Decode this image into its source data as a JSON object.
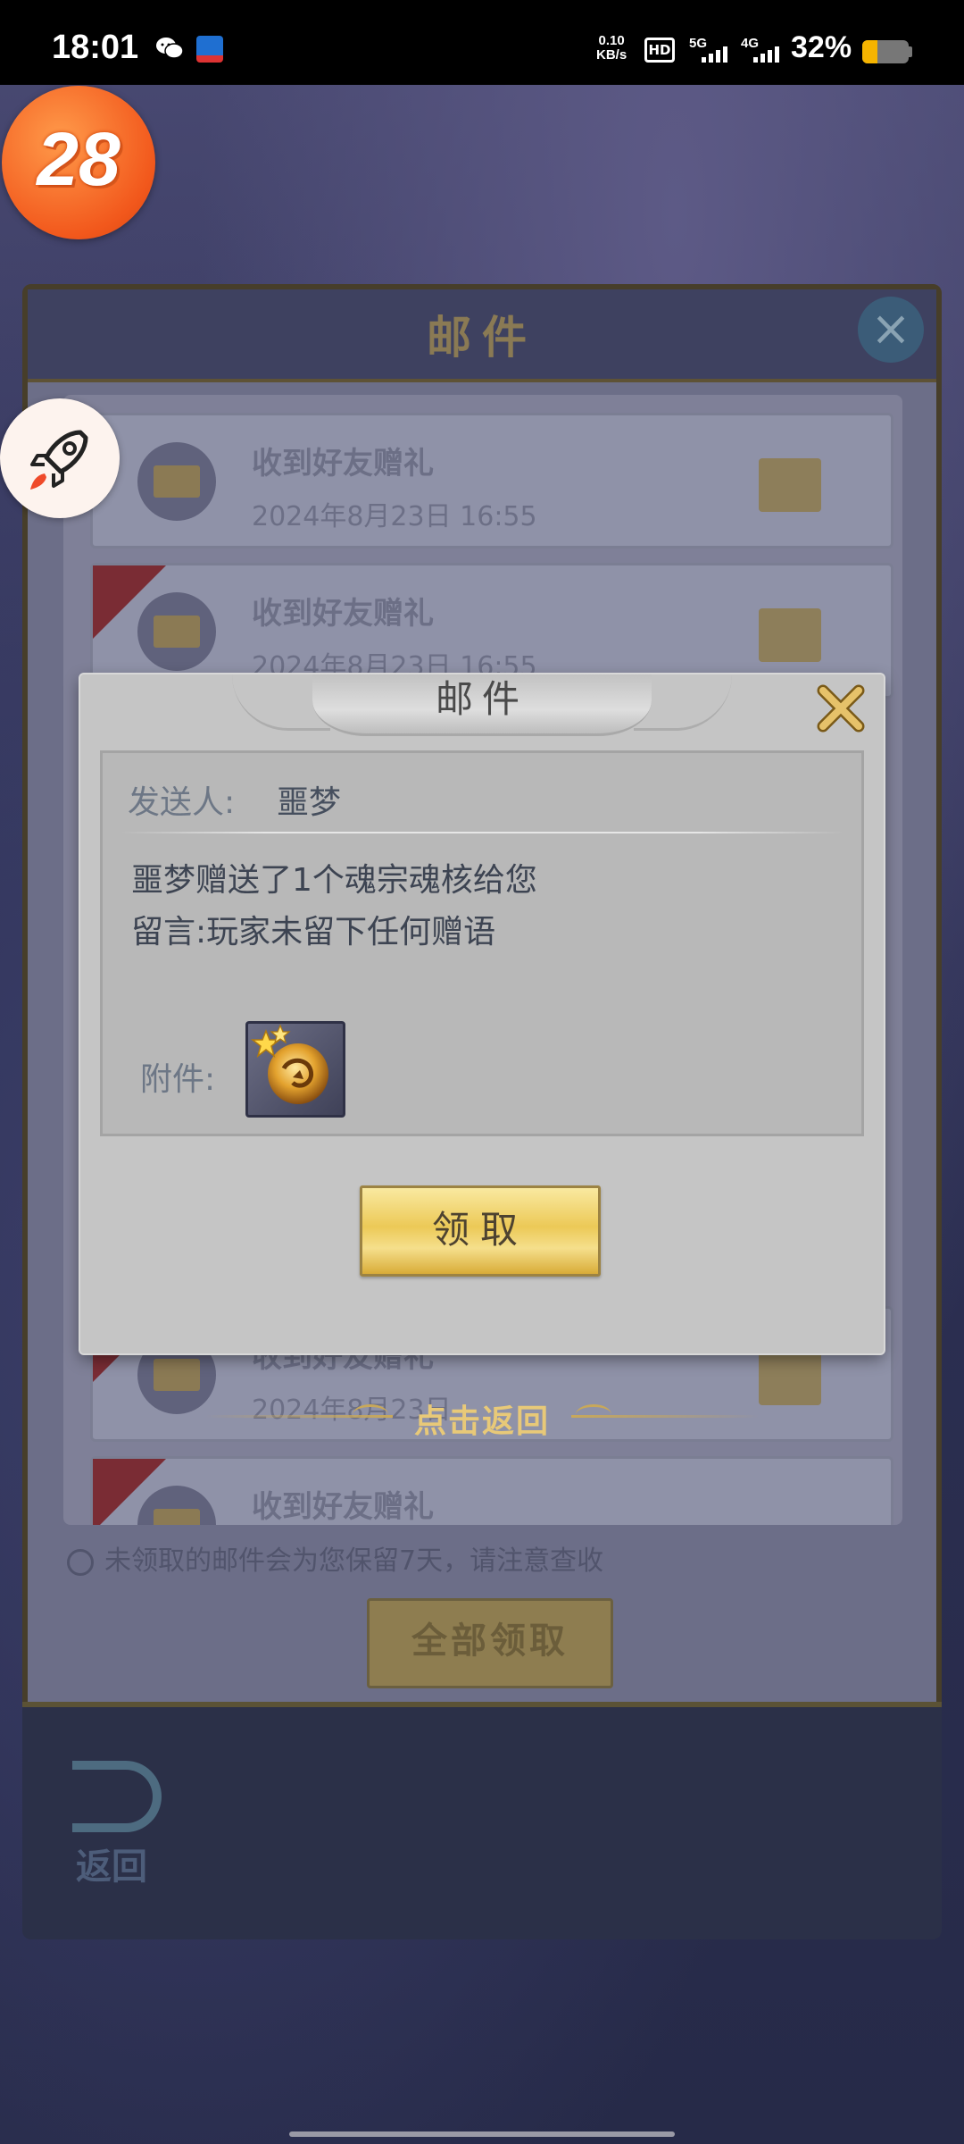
{
  "status_bar": {
    "time": "18:01",
    "net_speed_value": "0.10",
    "net_speed_unit": "KB/s",
    "hd_label": "HD",
    "network_1": "5G",
    "network_2": "4G",
    "battery_percent": "32%",
    "battery_level": 0.32,
    "battery_color": "#f5b400"
  },
  "floating_badge": {
    "text": "28"
  },
  "background_panel": {
    "title": "邮件",
    "rows": [
      {
        "title": "收到好友赠礼",
        "date": "2024年8月23日 16:55"
      },
      {
        "title": "收到好友赠礼",
        "date": "2024年8月23日 16:55"
      },
      {
        "title": "收到好友赠礼",
        "date": "2024年8月23日"
      },
      {
        "title": "收到好友赠礼",
        "date": ""
      }
    ],
    "note": "未领取的邮件会为您保留7天，请注意查收",
    "claim_all_label": "全部领取",
    "back_label": "返回"
  },
  "dialog": {
    "title": "邮件",
    "sender_label": "发送人:",
    "sender_name": "噩梦",
    "message_line1": "噩梦赠送了1个魂宗魂核给您",
    "message_line2": "留言:玩家未留下任何赠语",
    "attachment_label": "附件:",
    "attachment_icon": "soul-core-icon",
    "claim_label": "领取"
  },
  "tap_back_label": "点击返回",
  "colors": {
    "accent_gold": "#e8c978",
    "dialog_bg": "#c5c5c5",
    "badge_orange": "#f2581c"
  }
}
